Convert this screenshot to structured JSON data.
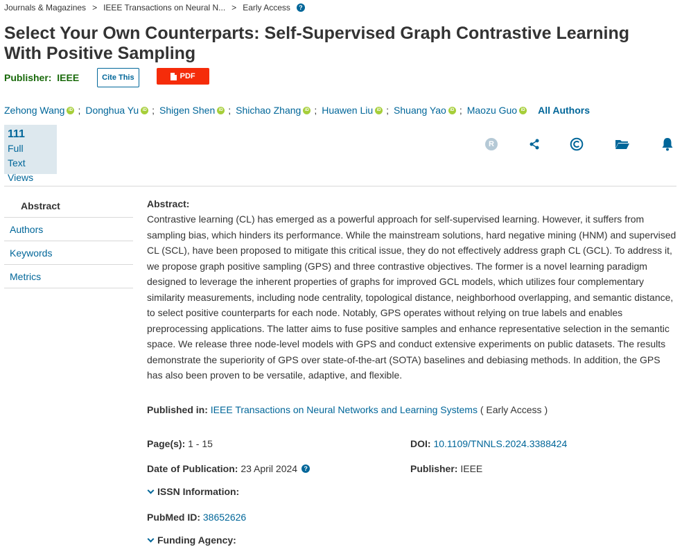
{
  "breadcrumb": {
    "items": [
      "Journals & Magazines",
      "IEEE Transactions on Neural N...",
      "Early Access"
    ],
    "separator": ">"
  },
  "article": {
    "title": "Select Your Own Counterparts: Self-Supervised Graph Contrastive Learning With Positive Sampling"
  },
  "publisher_row": {
    "label": "Publisher:",
    "value": "IEEE",
    "cite_label": "Cite This",
    "pdf_label": "PDF"
  },
  "authors": {
    "names": [
      "Zehong Wang",
      "Donghua Yu",
      "Shigen Shen",
      "Shichao Zhang",
      "Huawen Liu",
      "Shuang Yao",
      "Maozu Guo"
    ],
    "separator": ";",
    "all_authors_label": "All Authors",
    "orcid_badge": "iD"
  },
  "metrics": {
    "count": "111",
    "line1": "Full",
    "line2": "Text Views"
  },
  "actions": {
    "rights_badge": "R",
    "icons": [
      "rights-icon",
      "share-icon",
      "copyright-icon",
      "folder-icon",
      "bell-icon"
    ]
  },
  "side_nav": {
    "items": [
      "Abstract",
      "Authors",
      "Keywords",
      "Metrics"
    ]
  },
  "abstract": {
    "heading": "Abstract:",
    "text": "Contrastive learning (CL) has emerged as a powerful approach for self-supervised learning. However, it suffers from sampling bias, which hinders its performance. While the mainstream solutions, hard negative mining (HNM) and supervised CL (SCL), have been proposed to mitigate this critical issue, they do not effectively address graph CL (GCL). To address it, we propose graph positive sampling (GPS) and three contrastive objectives. The former is a novel learning paradigm designed to leverage the inherent properties of graphs for improved GCL models, which utilizes four complementary similarity measurements, including node centrality, topological distance, neighborhood overlapping, and semantic distance, to select positive counterparts for each node. Notably, GPS operates without relying on true labels and enables preprocessing applications. The latter aims to fuse positive samples and enhance representative selection in the semantic space. We release three node-level models with GPS and conduct extensive experiments on public datasets. The results demonstrate the superiority of GPS over state-of-the-art (SOTA) baselines and debiasing methods. In addition, the GPS has also been proven to be versatile, adaptive, and flexible."
  },
  "published_in": {
    "label": "Published in:",
    "journal": "IEEE Transactions on Neural Networks and Learning Systems",
    "status": "( Early Access )"
  },
  "meta": {
    "pages_label": "Page(s):",
    "pages_value": "1 - 15",
    "doi_label": "DOI:",
    "doi_value": "10.1109/TNNLS.2024.3388424",
    "date_label": "Date of Publication:",
    "date_value": "23 April 2024",
    "publisher_label": "Publisher:",
    "publisher_value": "IEEE",
    "issn_label": "ISSN Information:",
    "pubmed_label": "PubMed ID:",
    "pubmed_value": "38652626",
    "funding_label": "Funding Agency:"
  },
  "colors": {
    "link": "#006699",
    "publisher_green": "#18690a",
    "pdf_red": "#f52c0a",
    "orcid_green": "#a6ce39",
    "metrics_bg": "#dde8ee"
  }
}
